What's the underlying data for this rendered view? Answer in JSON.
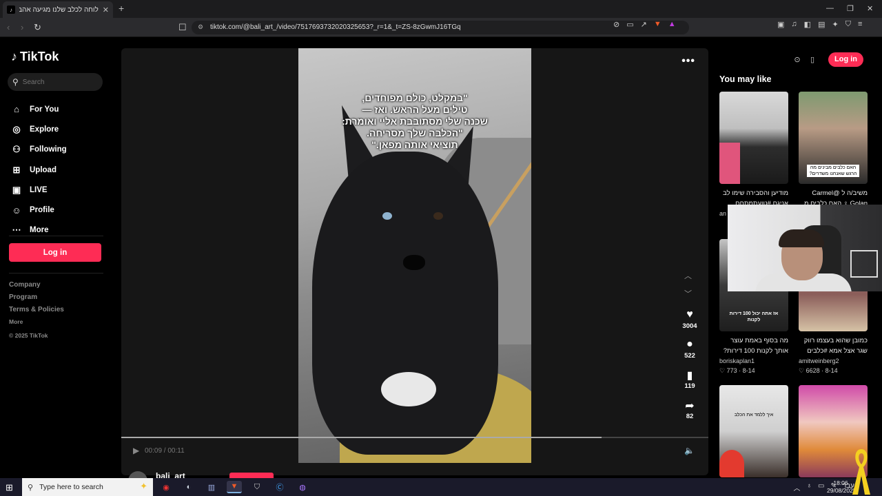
{
  "browser": {
    "tab_title": "לוחה לכלב שלנו מגיעה אהבה כי",
    "tab_favicon": "tiktok-icon",
    "new_tab_glyph": "+",
    "url": "tiktok.com/@bali_art_/video/7517693732020325653?_r=1&_t=ZS-8zGwmJ16TGq"
  },
  "sidebar": {
    "brand": "TikTok",
    "search_placeholder": "Search",
    "nav_items": [
      {
        "label": "For You",
        "icon": "home-icon"
      },
      {
        "label": "Explore",
        "icon": "compass-icon"
      },
      {
        "label": "Following",
        "icon": "following-icon"
      },
      {
        "label": "Upload",
        "icon": "upload-icon"
      },
      {
        "label": "LIVE",
        "icon": "live-icon"
      },
      {
        "label": "Profile",
        "icon": "profile-icon"
      },
      {
        "label": "More",
        "icon": "more-icon"
      }
    ],
    "login_label": "Log in",
    "footer": {
      "company": "Company",
      "program": "Program",
      "terms": "Terms & Policies",
      "more": "More",
      "copyright": "© 2025 TikTok"
    }
  },
  "video": {
    "caption": "\"במקלט, כולם מפוחדים,\nטילים מעל הראש. ואז —\nשכנה שלי מסתובבת אליי ואומרת:\n\"הכלבה שלך מסריחה.\nתוציאי אותה מפאן.\"",
    "likes": "3004",
    "comments": "522",
    "saves": "119",
    "shares": "82",
    "time": "00:09 / 00:11",
    "progress_fraction": 0.818,
    "author": "bali_art"
  },
  "right_panel": {
    "login_label": "Log in",
    "title": "You may like",
    "cards": [
      {
        "desc1": "מודיען והסבירה שימו לב",
        "desc2": "אניגם #טועתמתחם",
        "author": "an",
        "likes": "",
        "date": ""
      },
      {
        "desc1": "משיב/ה ל @Carmel",
        "desc2": "Golan ♀ האם כלבים מ...",
        "author": "",
        "likes": "",
        "date": ""
      },
      {
        "desc1": "מה בסוף באמת עוצר",
        "desc2": "אותך לקנות 100 דירות?",
        "author": "boriskaplan1",
        "likes": "773",
        "date": "8-14"
      },
      {
        "desc1": "כמובן שהוא בעצמו רווק",
        "desc2": "שגר אצל אמא #כלבים",
        "author": "amitweinberg2",
        "likes": "6628",
        "date": "8-14"
      }
    ],
    "thumb_texts": [
      "האם כלבים מבינים מה הרגש שאנחנו משדרים?",
      "אז אתה יכול 100 דירות לקנות",
      "איך ללמד את הכלב"
    ]
  },
  "taskbar": {
    "search_text": "Type here to search",
    "lang": "עבר",
    "time": "18:06",
    "date": "29/08/2025"
  }
}
